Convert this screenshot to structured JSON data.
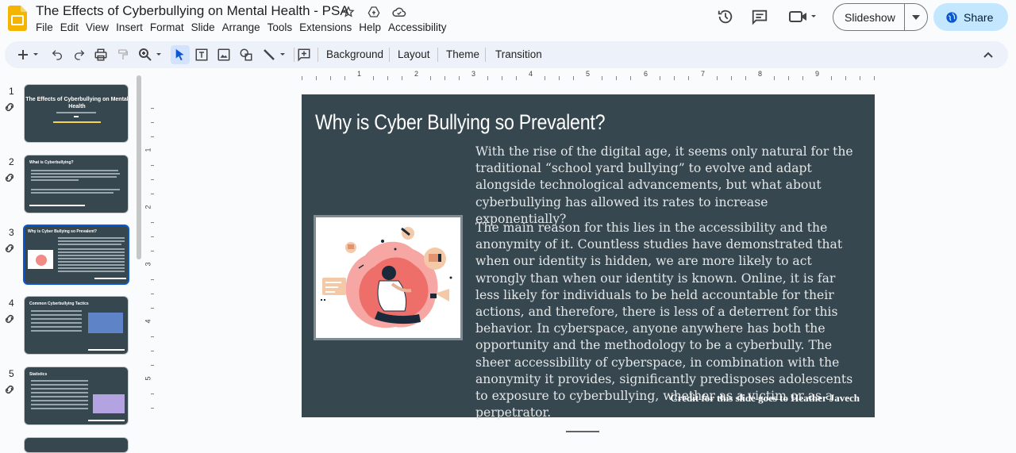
{
  "app": {
    "doc_title": "The Effects of Cyberbullying on Mental Health - PSA",
    "menu": [
      "File",
      "Edit",
      "View",
      "Insert",
      "Format",
      "Slide",
      "Arrange",
      "Tools",
      "Extensions",
      "Help",
      "Accessibility"
    ],
    "slideshow_label": "Slideshow",
    "share_label": "Share",
    "accent": "#0b57d0",
    "share_bg": "#c2e7ff"
  },
  "toolbar": {
    "background_label": "Background",
    "layout_label": "Layout",
    "theme_label": "Theme",
    "transition_label": "Transition"
  },
  "ruler": {
    "h_numbers": [
      "1",
      "2",
      "3",
      "4",
      "5",
      "6",
      "7",
      "8",
      "9"
    ],
    "v_numbers": [
      "1",
      "2",
      "3",
      "4",
      "5"
    ]
  },
  "filmstrip": {
    "slides": [
      {
        "num": "1",
        "title": "The Effects of Cyberbullying on Mental Health"
      },
      {
        "num": "2",
        "title": "What is Cyberbullying?"
      },
      {
        "num": "3",
        "title": "Why is Cyber Bullying so Prevalent?"
      },
      {
        "num": "4",
        "title": "Common Cyberbullying Tactics"
      },
      {
        "num": "5",
        "title": "Statistics"
      }
    ],
    "selected_index": 2
  },
  "slide": {
    "title": "Why is Cyber Bullying so Prevalent?",
    "paragraph1": "With the rise of the digital age, it seems only natural for the traditional “school yard bullying” to evolve and adapt alongside technological advancements, but what about cyberbullying has allowed its rates to increase exponentially?",
    "paragraph2": "The main reason for this lies in the accessibility and the anonymity of it. Countless studies have demonstrated that when our identity is hidden, we are more likely to act wrongly than when our identity is known. Online, it is far less likely for individuals to be held accountable for their actions, and therefore, there is less of a deterrent for this behavior. In cyberspace, anyone anywhere has both the opportunity and the methodology to be a cyberbully. The sheer accessibility of cyberspace, in combination with the anonymity it provides, significantly predisposes adolescents to exposure to cyberbullying, whether as a victim or as a perpetrator.",
    "credit": "Credit for this slide goes to Heather Javech",
    "background": "#37474f"
  }
}
